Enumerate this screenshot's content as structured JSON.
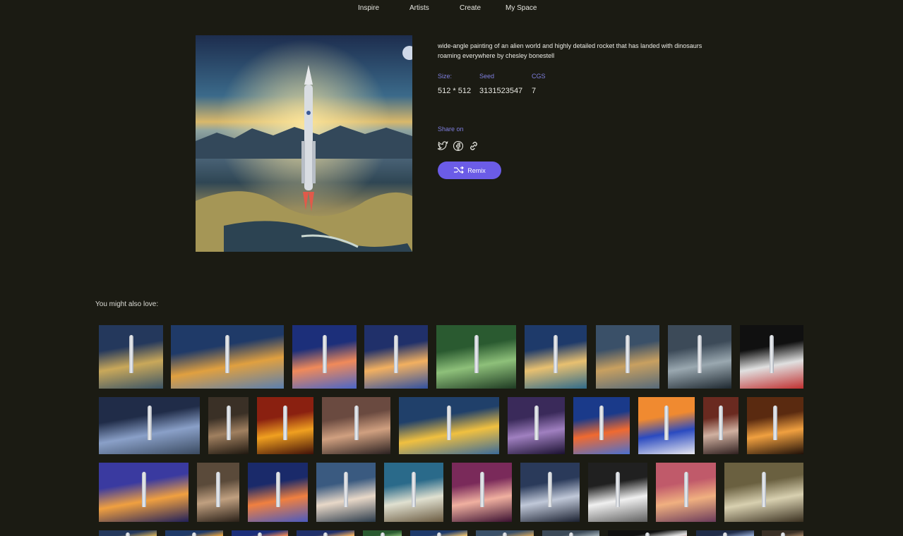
{
  "nav": {
    "items": [
      "Inspire",
      "Artists",
      "Create",
      "My Space"
    ]
  },
  "detail": {
    "prompt": "wide-angle painting of an alien world and highly detailed rocket that has landed with dinosaurs roaming everywhere by chesley bonestell",
    "size_label": "Size:",
    "size_value": "512 * 512",
    "seed_label": "Seed",
    "seed_value": "3131523547",
    "cgs_label": "CGS",
    "cgs_value": "7",
    "share_label": "Share on",
    "share_icons": [
      "twitter-icon",
      "facebook-icon",
      "link-icon"
    ],
    "remix_label": "Remix",
    "accent_color": "#6b5ce7"
  },
  "related": {
    "title": "You might also love:"
  }
}
